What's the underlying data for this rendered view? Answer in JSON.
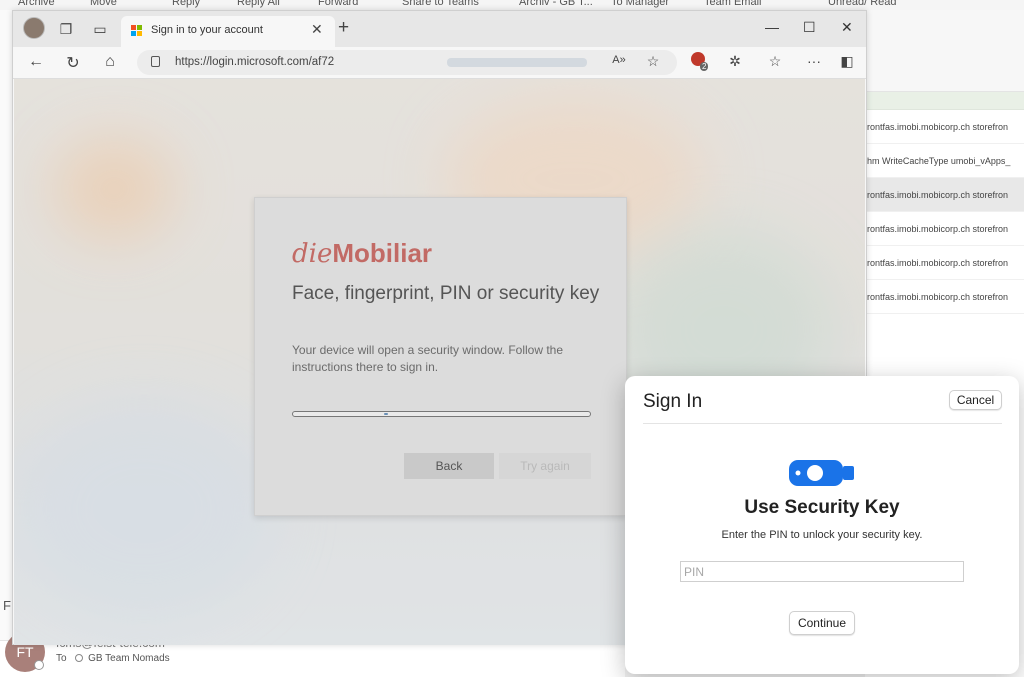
{
  "outlook": {
    "ribbon": [
      "Archive",
      "Move",
      "Reply",
      "Reply All",
      "Forward",
      "Share to Teams",
      "Archiv - GB T...",
      "To Manager",
      "Team Email",
      "Unread/ Read"
    ],
    "rows": [
      "rontfas.imobi.mobicorp.ch storefron",
      "hm  WriteCacheType  umobi_vApps_",
      "rontfas.imobi.mobicorp.ch storefron",
      "rontfas.imobi.mobicorp.ch storefron",
      "rontfas.imobi.mobicorp.ch storefron",
      "rontfas.imobi.mobicorp.ch storefron"
    ],
    "avatar_initials": "FT",
    "from": "fcms@feist-tele.com",
    "to_label": "To",
    "to_value": "GB Team Nomads",
    "side_letter": "F"
  },
  "browser": {
    "tab_title": "Sign in to your account",
    "url": "https://login.microsoft.com/af72",
    "extension_count": "2"
  },
  "signin": {
    "brand_die": "die",
    "brand_mobiliar": "Mobiliar",
    "title": "Face, fingerprint, PIN or security key",
    "description": "Your device will open a security window. Follow the instructions there to sign in.",
    "progress": 0.31,
    "back_label": "Back",
    "try_again_label": "Try again"
  },
  "dialog": {
    "title": "Sign In",
    "cancel_label": "Cancel",
    "heading": "Use Security Key",
    "subtitle": "Enter the PIN to unlock your security key.",
    "pin_placeholder": "PIN",
    "continue_label": "Continue",
    "accent_color": "#1a73e8"
  }
}
